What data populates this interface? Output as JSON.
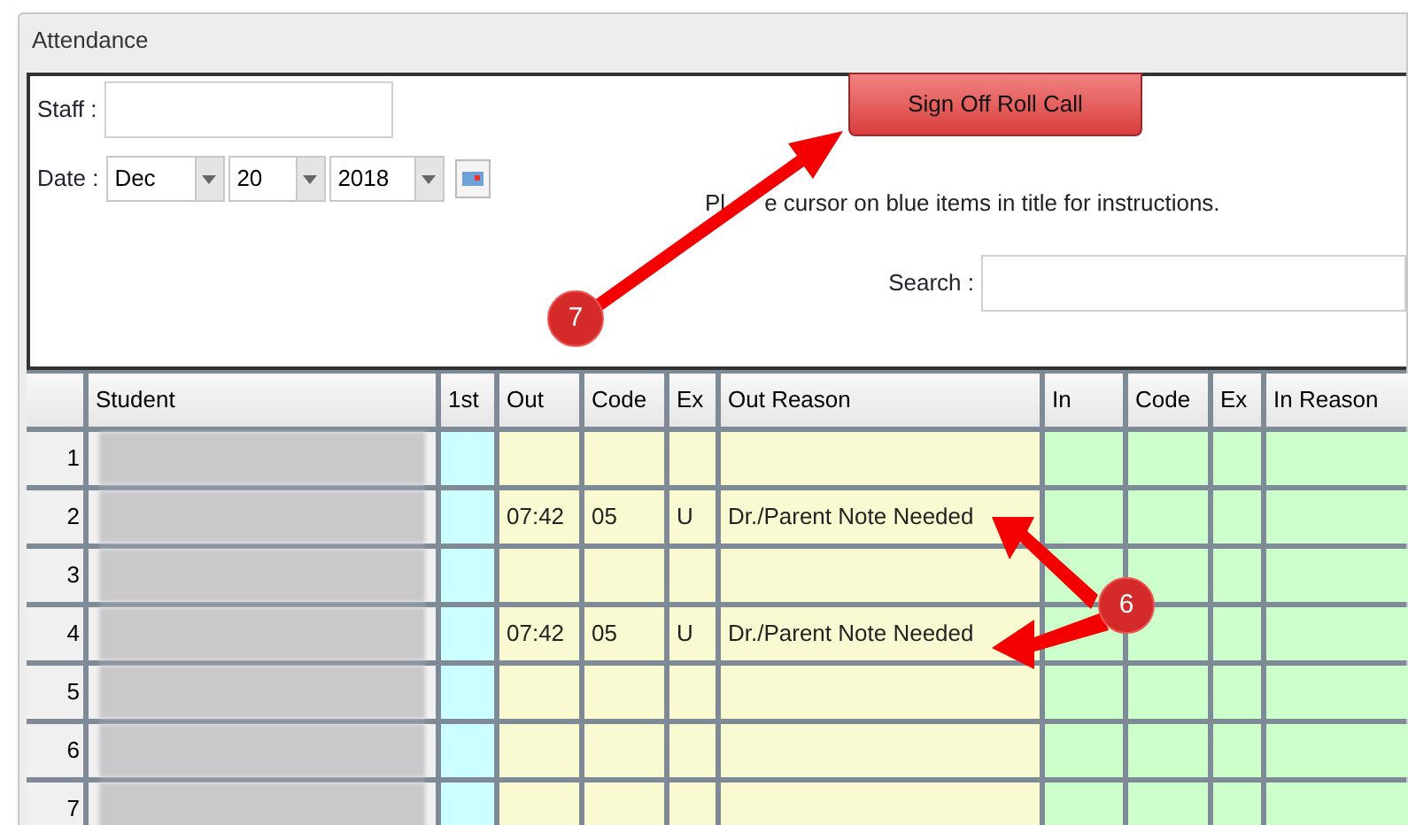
{
  "panel": {
    "title": "Attendance"
  },
  "staff": {
    "label": "Staff :"
  },
  "date": {
    "label": "Date :",
    "month": "Dec",
    "day": "20",
    "year": "2018"
  },
  "sign_off_button": "Sign Off Roll Call",
  "instructions": [
    "Pl",
    "e cursor on blue items in title for instructions."
  ],
  "search": {
    "label": "Search :"
  },
  "table": {
    "columns": [
      "Student",
      "1st",
      "Out",
      "Code",
      "Ex",
      "Out Reason",
      "In",
      "Code",
      "Ex",
      "In Reason"
    ],
    "rows": [
      {
        "number": "1"
      },
      {
        "number": "2",
        "out": "07:42",
        "out_code": "05",
        "out_ex": "U",
        "out_reason": "Dr./Parent Note Needed"
      },
      {
        "number": "3"
      },
      {
        "number": "4",
        "out": "07:42",
        "out_code": "05",
        "out_ex": "U",
        "out_reason": "Dr./Parent Note Needed"
      },
      {
        "number": "5"
      },
      {
        "number": "6"
      },
      {
        "number": "7"
      }
    ]
  },
  "annotations": [
    {
      "label": "7"
    },
    {
      "label": "6"
    }
  ]
}
